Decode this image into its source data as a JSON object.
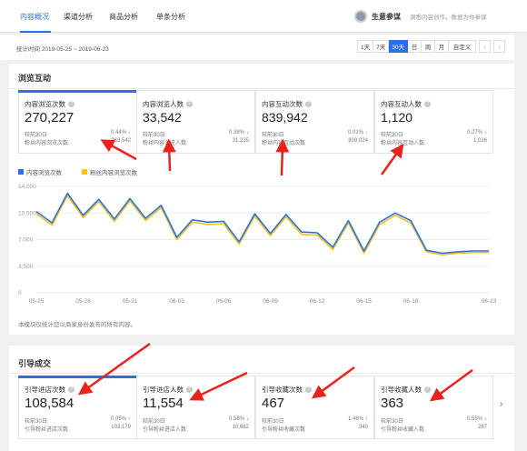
{
  "nav": {
    "tabs": [
      {
        "label": "内容概况"
      },
      {
        "label": "渠道分析"
      },
      {
        "label": "商品分析"
      },
      {
        "label": "单条分析"
      }
    ],
    "coach_title": "生意参谋",
    "coach_subtitle": "洞悉内容创作，数据为你参谋"
  },
  "datebar": {
    "range_text": "统计时间 2019-05-25 ~ 2019-06-23",
    "periods": [
      "1天",
      "7天",
      "30天",
      "日",
      "周",
      "月",
      "自定义"
    ],
    "active_period": "30天",
    "prev": "‹",
    "next": "›"
  },
  "browse": {
    "title": "浏览互动",
    "cards": [
      {
        "title": "内容浏览次数",
        "value": "270,227",
        "compare_label": "较前30日",
        "compare_pct": "0.44%",
        "compare_dir": "down",
        "fan_label": "粉丝内容浏览次数",
        "fan_value": "263,542"
      },
      {
        "title": "内容浏览人数",
        "value": "33,542",
        "compare_label": "较前30日",
        "compare_pct": "0.38%",
        "compare_dir": "down",
        "fan_label": "粉丝内容浏览人数",
        "fan_value": "31,235"
      },
      {
        "title": "内容互动次数",
        "value": "839,942",
        "compare_label": "较前30日",
        "compare_pct": "0.01%",
        "compare_dir": "down",
        "fan_label": "粉丝内容互动次数",
        "fan_value": "809,024"
      },
      {
        "title": "内容互动人数",
        "value": "1,120",
        "compare_label": "较前30日",
        "compare_pct": "0.27%",
        "compare_dir": "down",
        "fan_label": "粉丝内容互动人数",
        "fan_value": "1,026"
      }
    ],
    "note": "本模块仅统计您以商家身份发布的所有内容。"
  },
  "chart_data": {
    "type": "line",
    "x": [
      "05-25",
      "05-26",
      "05-27",
      "05-28",
      "05-29",
      "05-30",
      "05-31",
      "06-01",
      "06-02",
      "06-03",
      "06-04",
      "06-05",
      "06-06",
      "06-07",
      "06-08",
      "06-09",
      "06-10",
      "06-11",
      "06-12",
      "06-13",
      "06-14",
      "06-15",
      "06-16",
      "06-17",
      "06-18",
      "06-19",
      "06-20",
      "06-21",
      "06-22",
      "06-23"
    ],
    "xticks": [
      "05-25",
      "05-28",
      "05-31",
      "06-03",
      "06-06",
      "06-09",
      "06-12",
      "06-15",
      "06-18",
      "06-23"
    ],
    "yticks": [
      "0",
      "3,500",
      "7,000",
      "10,500",
      "14,000"
    ],
    "ylim": [
      0,
      14000
    ],
    "series": [
      {
        "name": "内容浏览次数",
        "color": "#2c6ee8",
        "values": [
          10700,
          9200,
          13100,
          10200,
          12300,
          9700,
          12400,
          9800,
          11500,
          7300,
          9600,
          9300,
          9400,
          6700,
          10400,
          7800,
          10300,
          8000,
          7900,
          6000,
          9500,
          5500,
          9300,
          10500,
          9500,
          5600,
          5200,
          5400,
          5500,
          5500
        ]
      },
      {
        "name": "粉丝内容浏览次数",
        "color": "#f0c419",
        "values": [
          10400,
          8900,
          12800,
          9900,
          12000,
          9400,
          12100,
          9500,
          11200,
          7000,
          9300,
          9000,
          9100,
          6400,
          10100,
          7500,
          10000,
          7700,
          7600,
          5700,
          9200,
          5200,
          9000,
          10200,
          9200,
          5400,
          5000,
          5200,
          5300,
          5300
        ]
      }
    ]
  },
  "guide": {
    "title": "引导成交",
    "cards": [
      {
        "title": "引导进店次数",
        "value": "108,584",
        "compare_label": "较前30日",
        "compare_pct": "0.05%",
        "compare_dir": "up",
        "fan_label": "引导粉丝进店次数",
        "fan_value": "103,179"
      },
      {
        "title": "引导进店人数",
        "value": "11,554",
        "compare_label": "较前30日",
        "compare_pct": "0.58%",
        "compare_dir": "down",
        "fan_label": "引导粉丝进店人数",
        "fan_value": "10,682"
      },
      {
        "title": "引导收藏次数",
        "value": "467",
        "compare_label": "较前30日",
        "compare_pct": "1.48%",
        "compare_dir": "down",
        "fan_label": "引导粉丝收藏次数",
        "fan_value": "340"
      },
      {
        "title": "引导收藏人数",
        "value": "363",
        "compare_label": "较前30日",
        "compare_pct": "0.55%",
        "compare_dir": "down",
        "fan_label": "引导粉丝收藏人数",
        "fan_value": "267"
      }
    ],
    "more": "›"
  },
  "colors": {
    "accent": "#2c6ee8",
    "down": "#2aa05a",
    "up": "#e64545",
    "annotation": "#e8231b"
  },
  "icons": {
    "question": "?",
    "down_arrow": "↓",
    "up_arrow": "↑"
  }
}
